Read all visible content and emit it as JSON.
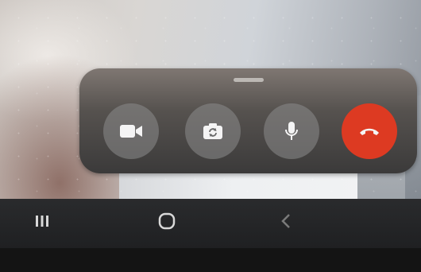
{
  "call_controls": {
    "video_icon": "video-camera-icon",
    "flip_camera_icon": "flip-camera-icon",
    "mic_icon": "microphone-icon",
    "end_call_icon": "end-call-phone-icon",
    "end_call_color": "#dd3a22",
    "button_color": "#8c8c8c"
  },
  "nav_bar": {
    "recents_icon": "recents-icon",
    "home_icon": "home-icon",
    "back_icon": "back-icon"
  }
}
